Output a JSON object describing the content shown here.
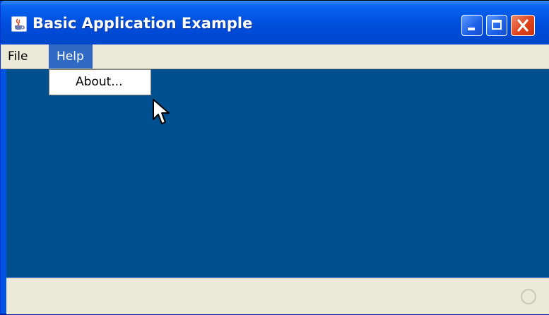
{
  "window": {
    "title": "Basic Application Example",
    "icon": "java-cup-icon",
    "buttons": [
      "minimize-icon",
      "maximize-icon",
      "close-icon"
    ]
  },
  "menubar": {
    "items": [
      {
        "label": "File"
      },
      {
        "label": "Help",
        "state": "open"
      }
    ]
  },
  "help_menu": {
    "items": [
      {
        "label": "About..."
      }
    ]
  },
  "colors": {
    "titlebar": "#0052e0",
    "content_background": "#00508f",
    "menu_highlight": "#316ac5",
    "close_button": "#e0431c"
  },
  "statusbar": {
    "busy_indicator": "busy-ring-icon"
  }
}
